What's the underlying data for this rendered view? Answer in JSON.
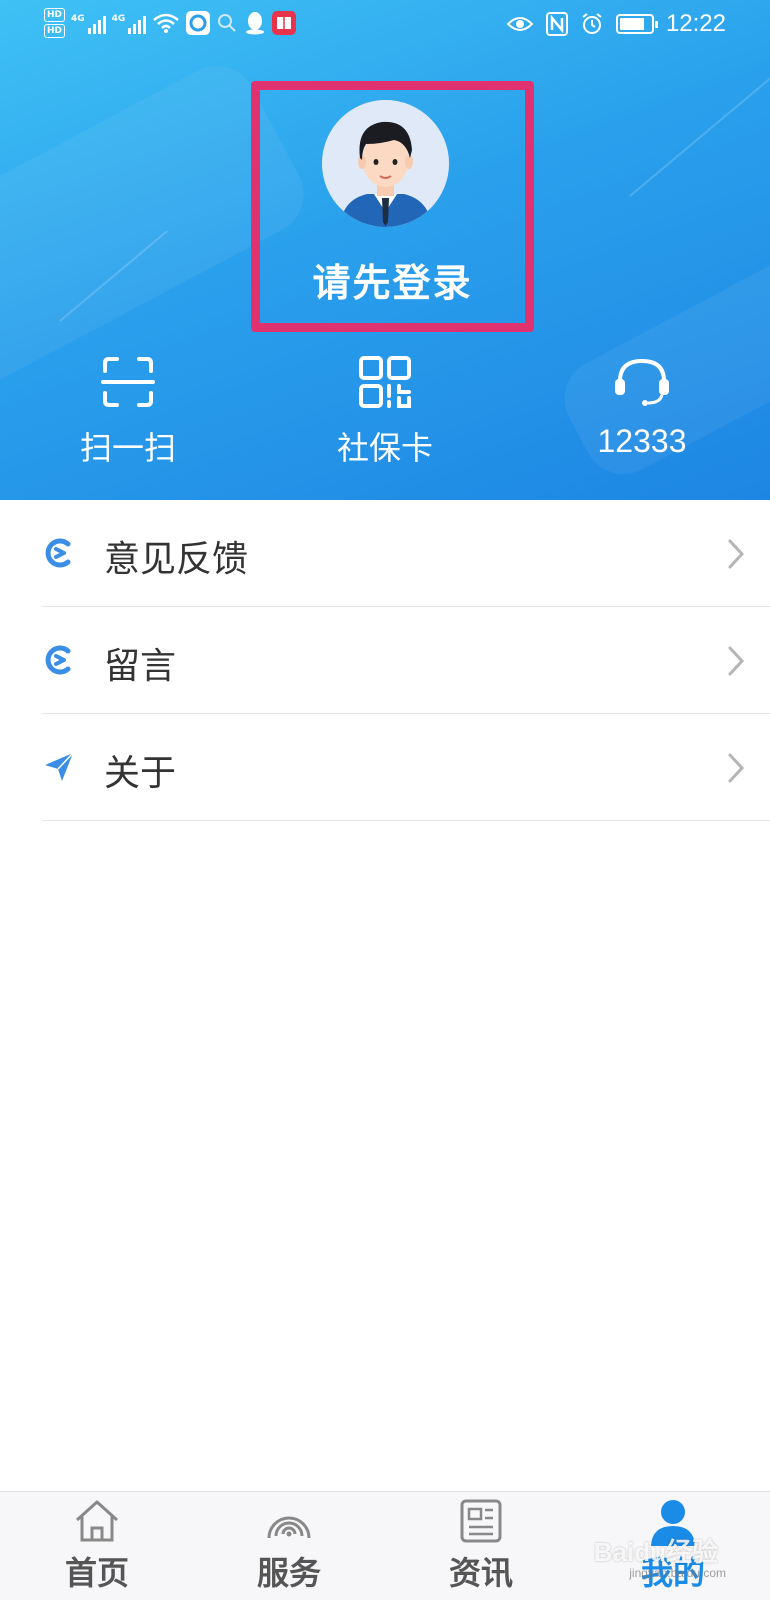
{
  "status_bar": {
    "time": "12:22",
    "hd1": "HD",
    "hd2": "HD",
    "net1": "4G",
    "net2": "4G"
  },
  "profile": {
    "login_prompt": "请先登录",
    "avatar_icon": "avatar-man-icon",
    "highlight_color": "#e0326e"
  },
  "quick_actions": [
    {
      "label": "扫一扫",
      "icon": "scan-icon"
    },
    {
      "label": "社保卡",
      "icon": "qrcode-icon"
    },
    {
      "label": "12333",
      "icon": "headset-icon"
    }
  ],
  "menu": [
    {
      "label": "意见反馈",
      "icon": "feedback-icon"
    },
    {
      "label": "留言",
      "icon": "message-icon"
    },
    {
      "label": "关于",
      "icon": "location-arrow-icon"
    }
  ],
  "bottom_nav": [
    {
      "label": "首页",
      "icon": "home-icon",
      "active": false
    },
    {
      "label": "服务",
      "icon": "service-icon",
      "active": false
    },
    {
      "label": "资讯",
      "icon": "news-icon",
      "active": false
    },
    {
      "label": "我的",
      "icon": "user-icon",
      "active": true
    }
  ],
  "watermark": {
    "text": "Baidu经验",
    "sub": "jingyan.baidu.com"
  },
  "colors": {
    "header_gradient_start": "#3fc1f5",
    "header_gradient_end": "#1d86e3",
    "accent": "#1b8be8",
    "icon_blue": "#3a8ee6"
  }
}
